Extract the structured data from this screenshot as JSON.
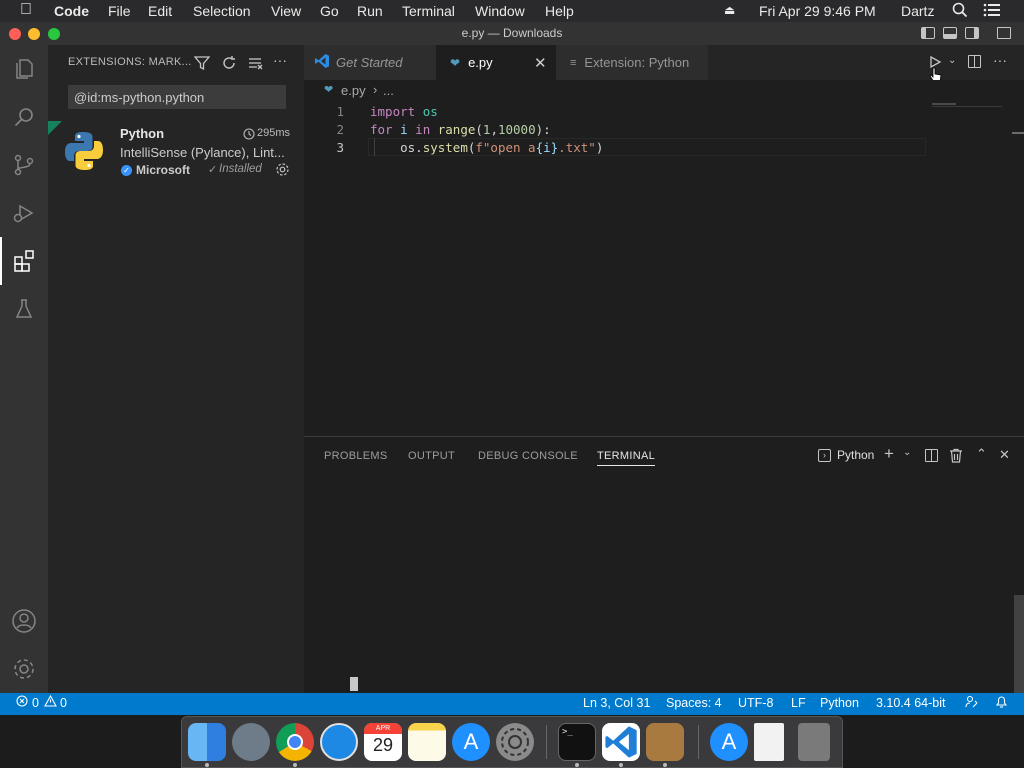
{
  "menubar": {
    "app": "Code",
    "items": [
      "File",
      "Edit",
      "Selection",
      "View",
      "Go",
      "Run",
      "Terminal",
      "Window",
      "Help"
    ],
    "clock": "Fri Apr 29  9:46 PM",
    "user": "Dartz"
  },
  "window": {
    "title": "e.py — Downloads"
  },
  "sidebar": {
    "title": "EXTENSIONS: MARK...",
    "search_value": "@id:ms-python.python",
    "extension": {
      "name": "Python",
      "time": "295ms",
      "description": "IntelliSense (Pylance), Lint...",
      "publisher": "Microsoft",
      "status": "Installed"
    }
  },
  "tabs": [
    {
      "label": "Get Started",
      "active": false
    },
    {
      "label": "e.py",
      "active": true
    },
    {
      "label": "Extension: Python",
      "active": false
    }
  ],
  "breadcrumb": {
    "file": "e.py",
    "rest": "..."
  },
  "code": {
    "line_numbers": [
      "1",
      "2",
      "3"
    ],
    "lines": [
      [
        {
          "t": "import ",
          "c": "kw"
        },
        {
          "t": "os",
          "c": "mod"
        }
      ],
      [
        {
          "t": "for ",
          "c": "kw"
        },
        {
          "t": "i ",
          "c": "var"
        },
        {
          "t": "in ",
          "c": "kw"
        },
        {
          "t": "range",
          "c": "fn"
        },
        {
          "t": "(",
          "c": "plain"
        },
        {
          "t": "1",
          "c": "num"
        },
        {
          "t": ",",
          "c": "plain"
        },
        {
          "t": "10000",
          "c": "num"
        },
        {
          "t": "):",
          "c": "plain"
        }
      ],
      [
        {
          "t": "    os.",
          "c": "plain"
        },
        {
          "t": "system",
          "c": "fn"
        },
        {
          "t": "(",
          "c": "plain"
        },
        {
          "t": "f\"open a",
          "c": "str"
        },
        {
          "t": "{i}",
          "c": "var"
        },
        {
          "t": ".txt\"",
          "c": "str"
        },
        {
          "t": ")",
          "c": "plain"
        }
      ]
    ]
  },
  "panel": {
    "tabs": [
      "PROBLEMS",
      "OUTPUT",
      "DEBUG CONSOLE",
      "TERMINAL"
    ],
    "active_tab": "TERMINAL",
    "terminal_name": "Python"
  },
  "status": {
    "errors": "0",
    "warnings": "0",
    "position": "Ln 3, Col 31",
    "spaces": "Spaces: 4",
    "encoding": "UTF-8",
    "eol": "LF",
    "language": "Python",
    "interpreter": "3.10.4 64-bit"
  },
  "dock": {
    "calendar_month": "APR",
    "calendar_day": "29"
  },
  "colors": {
    "accent": "#007acc",
    "activity": "#333333",
    "sidebar": "#252526",
    "editor": "#1e1e1e"
  }
}
